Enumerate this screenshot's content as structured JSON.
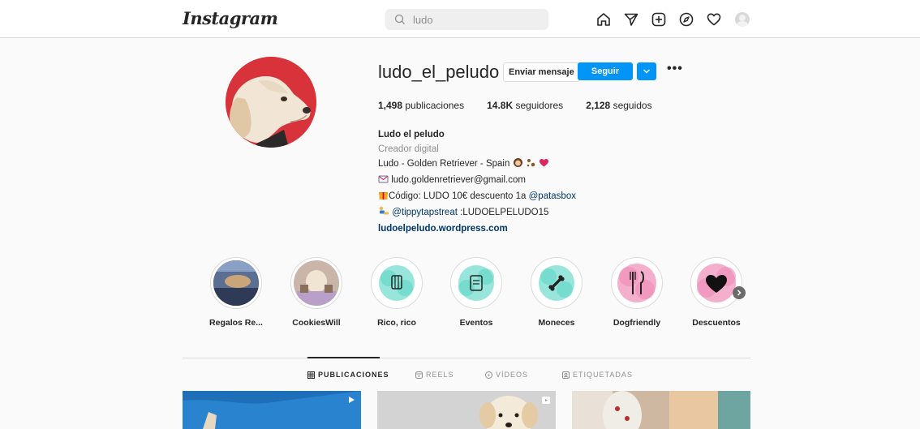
{
  "nav": {
    "logo": "Instagram",
    "search_placeholder": "ludo",
    "icons": [
      "home-icon",
      "direct-icon",
      "new-post-icon",
      "explore-icon",
      "activity-icon",
      "profile-avatar"
    ]
  },
  "profile": {
    "username": "ludo_el_peludo",
    "message_button": "Enviar mensaje",
    "follow_button": "Seguir",
    "more": "•••",
    "stats": {
      "posts_count": "1,498",
      "posts_label": "publicaciones",
      "followers_count": "14.8K",
      "followers_label": "seguidores",
      "following_count": "2,128",
      "following_label": "seguidos"
    },
    "bio": {
      "name": "Ludo el peludo",
      "category": "Creador digital",
      "line1": "Ludo - Golden Retriever - Spain",
      "line2": "ludo.goldenretriever@gmail.com",
      "line3_prefix": "Código: LUDO 10€ descuento 1a ",
      "line3_mention": "@patasbox",
      "line4_mention": "@tippytapstreat",
      "line4_suffix": " :LUDOELPELUDO15",
      "website": "ludoelpeludo.wordpress.com"
    }
  },
  "highlights": [
    {
      "label": "Regalos Re..."
    },
    {
      "label": "CookiesWill"
    },
    {
      "label": "Rico, rico"
    },
    {
      "label": "Eventos"
    },
    {
      "label": "Moneces"
    },
    {
      "label": "Dogfriendly"
    },
    {
      "label": "Descuentos"
    }
  ],
  "tabs": {
    "posts": "PUBLICACIONES",
    "reels": "REELS",
    "videos": "VÍDEOS",
    "tagged": "ETIQUETADAS"
  },
  "colors": {
    "accent": "#0095f6",
    "avatar_bg": "#d8323a",
    "highlight_teal": "#5fd6c4",
    "highlight_pink": "#f08bb7"
  }
}
